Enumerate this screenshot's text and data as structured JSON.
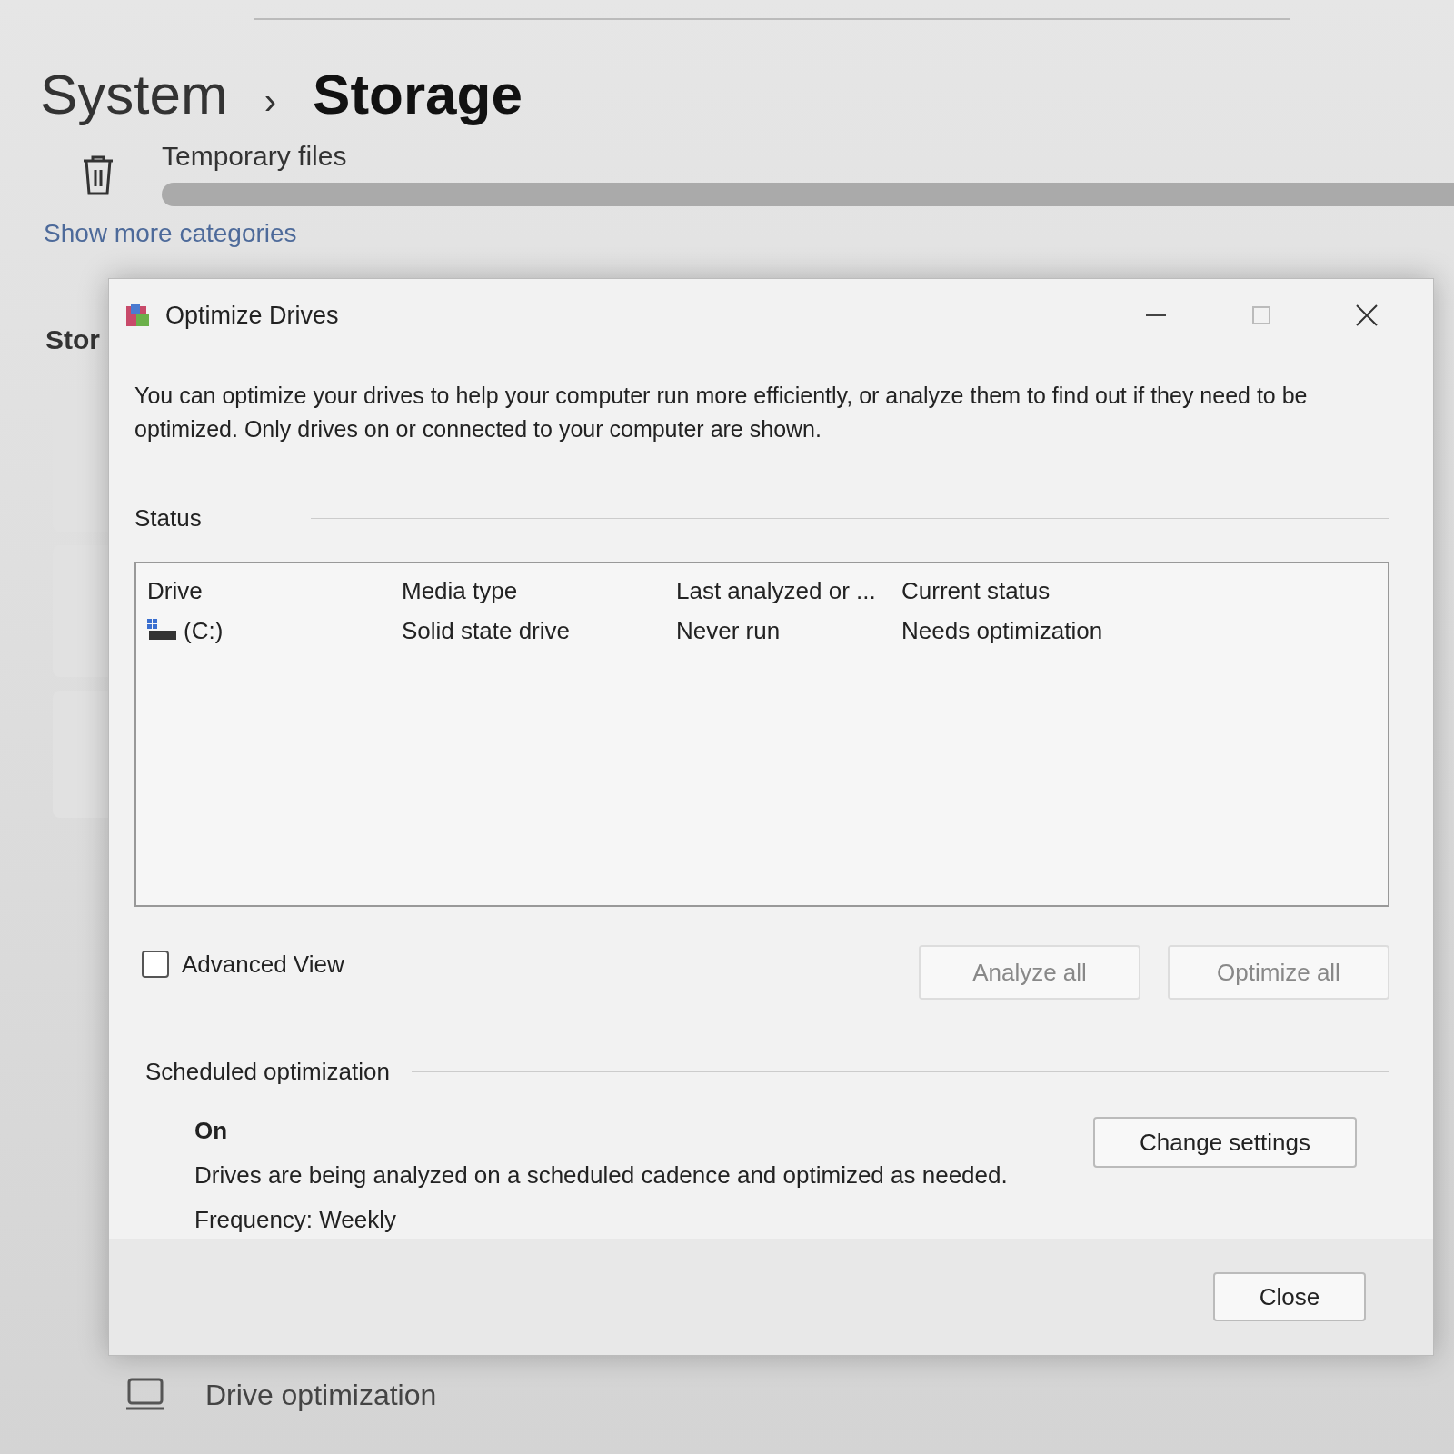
{
  "settings": {
    "breadcrumb": [
      "System",
      "Storage"
    ],
    "separator": "›",
    "category": "Temporary files",
    "link": "Show more categories",
    "section_heading": "Stor",
    "bottom_item": "Drive optimization"
  },
  "dialog": {
    "title": "Optimize Drives",
    "description": "You can optimize your drives to help your computer run more efficiently, or analyze them to find out if they need to be optimized. Only drives on or connected to your computer are shown.",
    "status_label": "Status",
    "table": {
      "columns": [
        "Drive",
        "Media type",
        "Last analyzed or ...",
        "Current status"
      ],
      "rows": [
        {
          "cells": [
            "(C:)",
            "Solid state drive",
            "Never run",
            "Needs optimization"
          ],
          "selected": false
        }
      ]
    },
    "advanced_view": {
      "label": "Advanced View",
      "checked": false
    },
    "buttons": [
      {
        "label": "Analyze all",
        "disabled": true
      },
      {
        "label": "Optimize all",
        "disabled": true
      }
    ],
    "scheduled": {
      "heading": "Scheduled optimization",
      "state": "On",
      "description": "Drives are being analyzed on a scheduled cadence and optimized as needed.",
      "frequency": "Frequency: Weekly",
      "button": "Change settings"
    },
    "close_button": "Close"
  }
}
